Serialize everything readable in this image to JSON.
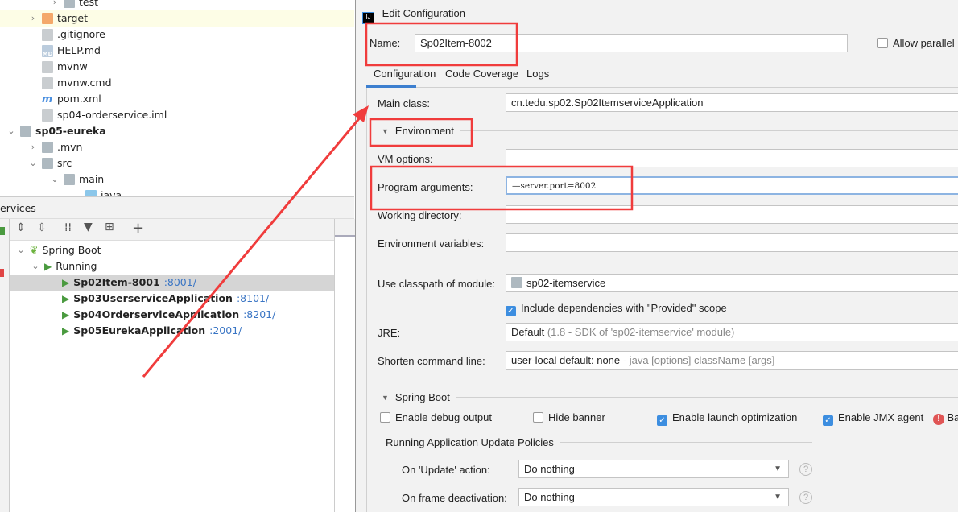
{
  "project_tree": [
    {
      "label": "test",
      "icon": "folder-icon",
      "indent": 2,
      "chevron": "right"
    },
    {
      "label": "target",
      "icon": "folder-orange-icon",
      "indent": 1,
      "chevron": "right",
      "highlight": true
    },
    {
      "label": ".gitignore",
      "icon": "gitignore-file-icon",
      "indent": 1
    },
    {
      "label": "HELP.md",
      "icon": "markdown-file-icon",
      "indent": 1
    },
    {
      "label": "mvnw",
      "icon": "script-file-icon",
      "indent": 1
    },
    {
      "label": "mvnw.cmd",
      "icon": "text-file-icon",
      "indent": 1
    },
    {
      "label": "pom.xml",
      "icon": "maven-icon",
      "indent": 1
    },
    {
      "label": "sp04-orderservice.iml",
      "icon": "iml-file-icon",
      "indent": 1
    },
    {
      "label": "sp05-eureka",
      "icon": "module-folder-icon",
      "indent": 0,
      "chevron": "down",
      "bold": true
    },
    {
      "label": ".mvn",
      "icon": "folder-icon",
      "indent": 1,
      "chevron": "right"
    },
    {
      "label": "src",
      "icon": "folder-icon",
      "indent": 1,
      "chevron": "down"
    },
    {
      "label": "main",
      "icon": "folder-icon",
      "indent": 2,
      "chevron": "down"
    },
    {
      "label": "java",
      "icon": "folder-blue-icon",
      "indent": 3,
      "chevron": "down"
    }
  ],
  "services": {
    "title": "ervices",
    "spring_boot": "Spring Boot",
    "running": "Running",
    "apps": [
      {
        "name": "Sp02Item-8001",
        "port": ":8001/",
        "selected": true
      },
      {
        "name": "Sp03UserserviceApplication",
        "port": ":8101/"
      },
      {
        "name": "Sp04OrderserviceApplication",
        "port": ":8201/"
      },
      {
        "name": "Sp05EurekaApplication",
        "port": ":2001/"
      }
    ]
  },
  "dialog": {
    "title": "Edit Configuration",
    "name_label": "Name:",
    "name_value": "Sp02Item-8002",
    "allow_parallel": "Allow parallel",
    "tabs": [
      "Configuration",
      "Code Coverage",
      "Logs"
    ],
    "active_tab": "Configuration",
    "main_class_label": "Main class:",
    "main_class_value": "cn.tedu.sp02.Sp02ItemserviceApplication",
    "environment": "Environment",
    "vm_options_label": "VM options:",
    "program_args_label": "Program arguments:",
    "program_args_value": "—server.port=8002",
    "working_dir_label": "Working directory:",
    "env_vars_label": "Environment variables:",
    "classpath_label": "Use classpath of module:",
    "classpath_value": "sp02-itemservice",
    "include_deps": "Include dependencies with \"Provided\" scope",
    "jre_label": "JRE:",
    "jre_value": "Default",
    "jre_hint": "(1.8 - SDK of 'sp02-itemservice' module)",
    "shorten_label": "Shorten command line:",
    "shorten_value": "user-local default: none",
    "shorten_hint": "- java [options] className [args]",
    "spring_boot": "Spring Boot",
    "enable_debug": "Enable debug output",
    "hide_banner": "Hide banner",
    "enable_launch": "Enable launch optimization",
    "enable_jmx": "Enable JMX agent",
    "truncated": "Ba",
    "policies": "Running Application Update Policies",
    "on_update_label": "On 'Update' action:",
    "on_update_value": "Do nothing",
    "on_frame_label": "On frame deactivation:",
    "on_frame_value": "Do nothing"
  },
  "colors": {
    "annotation": "#f03c3c",
    "accent": "#3d8ee0",
    "selection": "#d5d5d5",
    "highlight": "#fdfde6"
  }
}
